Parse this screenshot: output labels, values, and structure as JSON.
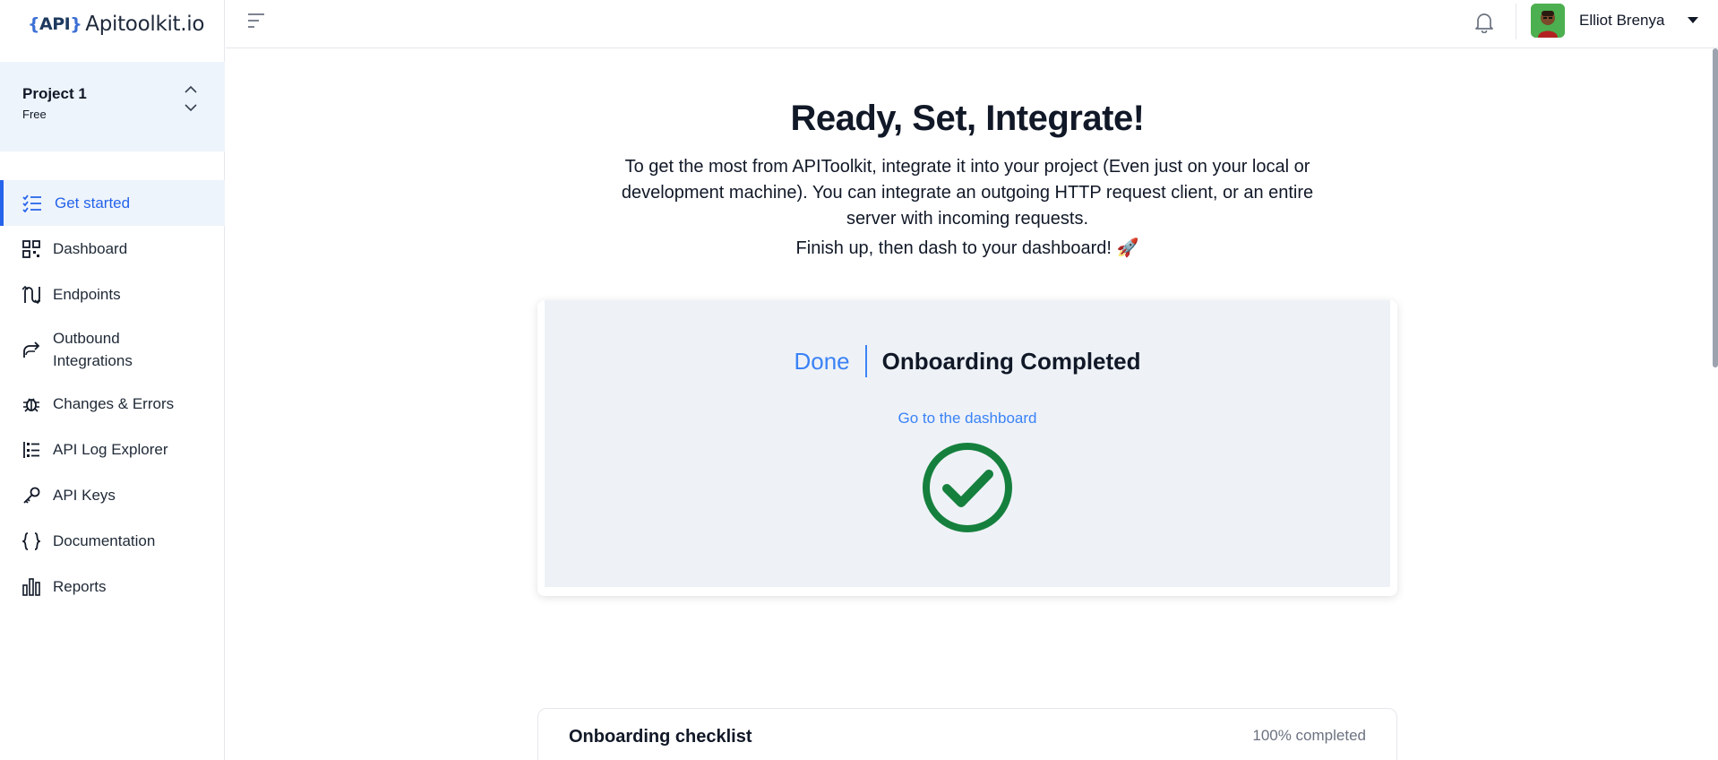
{
  "brand": {
    "logo_api": "API",
    "logo_text": "Apitoolkit.io"
  },
  "project": {
    "name": "Project 1",
    "plan": "Free"
  },
  "sidebar": {
    "items": [
      {
        "label": "Get started",
        "icon": "checklist-icon",
        "active": true
      },
      {
        "label": "Dashboard",
        "icon": "dashboard-grid-icon"
      },
      {
        "label": "Endpoints",
        "icon": "endpoints-route-icon"
      },
      {
        "label": "Outbound Integrations",
        "icon": "outbound-arrow-icon"
      },
      {
        "label": "Changes & Errors",
        "icon": "bug-icon"
      },
      {
        "label": "API Log Explorer",
        "icon": "log-list-icon"
      },
      {
        "label": "API Keys",
        "icon": "key-icon"
      },
      {
        "label": "Documentation",
        "icon": "curly-braces-icon"
      },
      {
        "label": "Reports",
        "icon": "bar-chart-icon"
      }
    ]
  },
  "header": {
    "user_name": "Elliot Brenya"
  },
  "main": {
    "title": "Ready, Set, Integrate!",
    "description": "To get the most from APIToolkit, integrate it into your project (Even just on your local or development machine). You can integrate an outgoing HTTP request client, or an entire server with incoming requests.",
    "finish_text": "Finish up, then dash to your dashboard! 🚀",
    "status_done": "Done",
    "status_text": "Onboarding Completed",
    "dashboard_link": "Go to the dashboard",
    "checklist_title": "Onboarding checklist",
    "checklist_progress": "100% completed"
  },
  "colors": {
    "accent": "#2563eb",
    "link": "#3b82f6",
    "success": "#15803d",
    "sidebar_active_bg": "#eef4fb"
  }
}
